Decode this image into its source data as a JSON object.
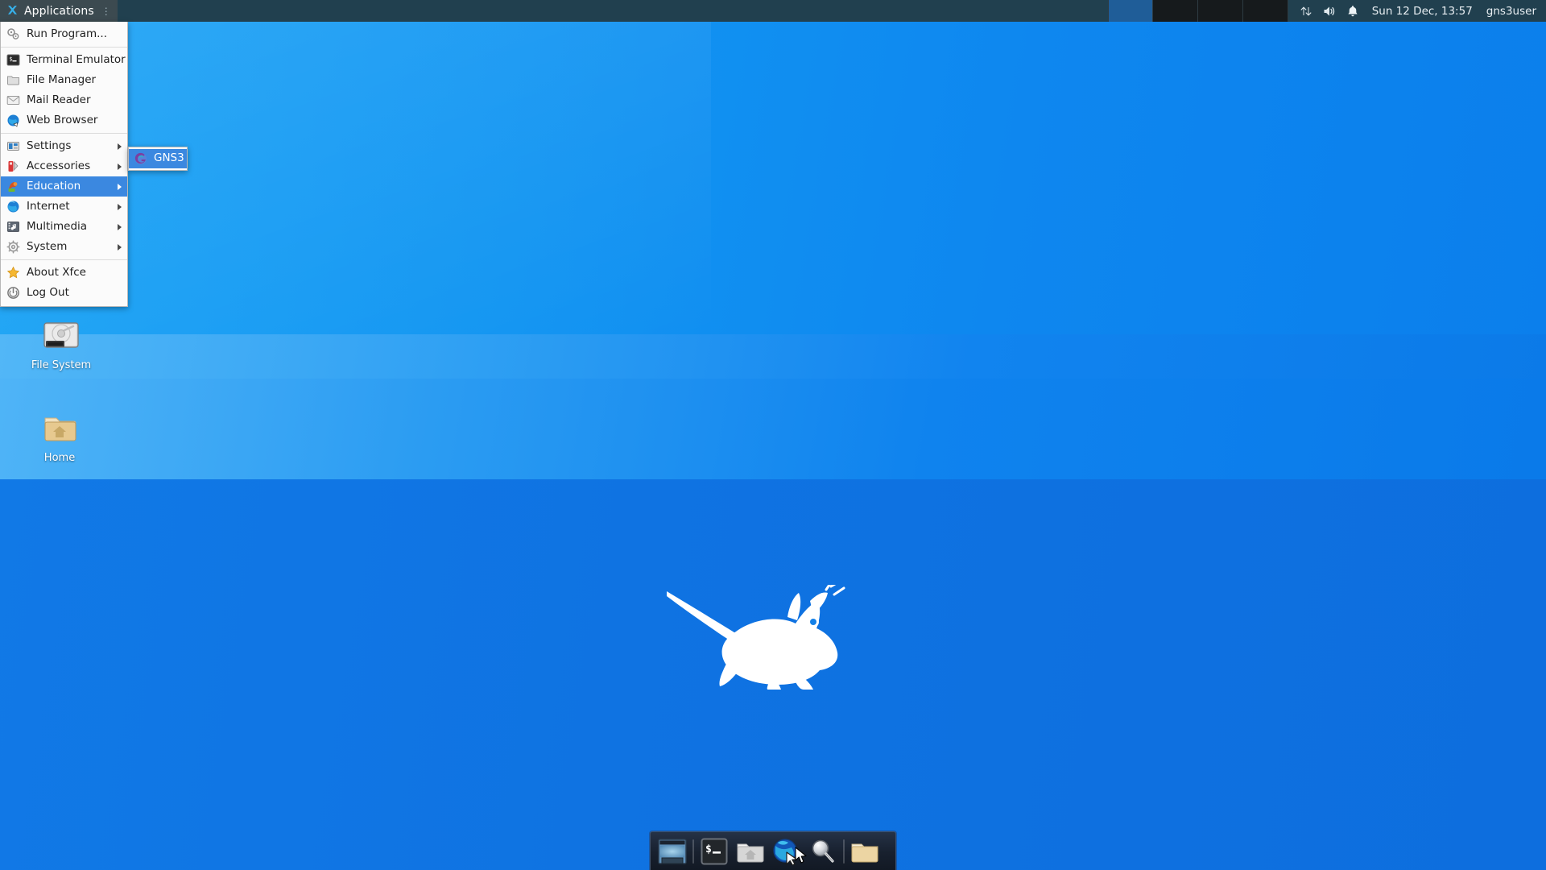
{
  "panel": {
    "apps_button": {
      "label": "Applications",
      "handle_icon": "grip-icon",
      "logo_icon": "xfce-x-icon"
    },
    "workspaces": [
      {
        "name": "workspace-1",
        "active": true
      },
      {
        "name": "workspace-2",
        "active": false
      },
      {
        "name": "workspace-3",
        "active": false
      },
      {
        "name": "workspace-4",
        "active": false
      }
    ],
    "tray": {
      "network_icon": "network-updown-icon",
      "volume_icon": "volume-icon",
      "notification_icon": "bell-icon",
      "clock": "Sun 12 Dec, 13:57",
      "username": "gns3user"
    },
    "colors": {
      "panel_bg": "#21404f",
      "apps_bg": "#3c4a50",
      "ws_active": "#1f5d98"
    }
  },
  "apps_menu": {
    "items": [
      {
        "label": "Run Program...",
        "icon": "gears-icon",
        "submenu": false,
        "selected": false,
        "sep_after": true
      },
      {
        "label": "Terminal Emulator",
        "icon": "terminal-icon",
        "submenu": false,
        "selected": false,
        "sep_after": false
      },
      {
        "label": "File Manager",
        "icon": "folder-icon",
        "submenu": false,
        "selected": false,
        "sep_after": false
      },
      {
        "label": "Mail Reader",
        "icon": "envelope-icon",
        "submenu": false,
        "selected": false,
        "sep_after": false
      },
      {
        "label": "Web Browser",
        "icon": "globe-icon",
        "submenu": false,
        "selected": false,
        "sep_after": true
      },
      {
        "label": "Settings",
        "icon": "settings-icon",
        "submenu": true,
        "selected": false,
        "sep_after": false
      },
      {
        "label": "Accessories",
        "icon": "accessories-icon",
        "submenu": true,
        "selected": false,
        "sep_after": false
      },
      {
        "label": "Education",
        "icon": "education-icon",
        "submenu": true,
        "selected": true,
        "sep_after": false
      },
      {
        "label": "Internet",
        "icon": "globe-icon",
        "submenu": true,
        "selected": false,
        "sep_after": false
      },
      {
        "label": "Multimedia",
        "icon": "multimedia-icon",
        "submenu": true,
        "selected": false,
        "sep_after": false
      },
      {
        "label": "System",
        "icon": "gear-icon",
        "submenu": true,
        "selected": false,
        "sep_after": true
      },
      {
        "label": "About Xfce",
        "icon": "star-icon",
        "submenu": false,
        "selected": false,
        "sep_after": false
      },
      {
        "label": "Log Out",
        "icon": "power-icon",
        "submenu": false,
        "selected": false,
        "sep_after": false
      }
    ],
    "highlight_color": "#3b88e0"
  },
  "submenu": {
    "parent": "Education",
    "items": [
      {
        "label": "GNS3",
        "icon": "gns3-icon",
        "selected": true
      }
    ]
  },
  "desktop": {
    "icons": [
      {
        "label": "File System",
        "icon": "harddisk-icon"
      },
      {
        "label": "Home",
        "icon": "home-folder-icon"
      }
    ],
    "logo_icon": "xfce-mouse-logo"
  },
  "dock": {
    "items": [
      {
        "name": "show-desktop",
        "icon": "show-desktop-icon"
      },
      {
        "name": "separator-1",
        "icon": "separator"
      },
      {
        "name": "terminal",
        "icon": "terminal-icon"
      },
      {
        "name": "file-manager",
        "icon": "home-folder-icon"
      },
      {
        "name": "web-browser",
        "icon": "globe-cursor-icon"
      },
      {
        "name": "find-files",
        "icon": "magnifier-icon"
      },
      {
        "name": "separator-2",
        "icon": "separator"
      },
      {
        "name": "folder",
        "icon": "folder-icon"
      }
    ]
  },
  "cursor": {
    "icon": "arrow-cursor-icon"
  }
}
